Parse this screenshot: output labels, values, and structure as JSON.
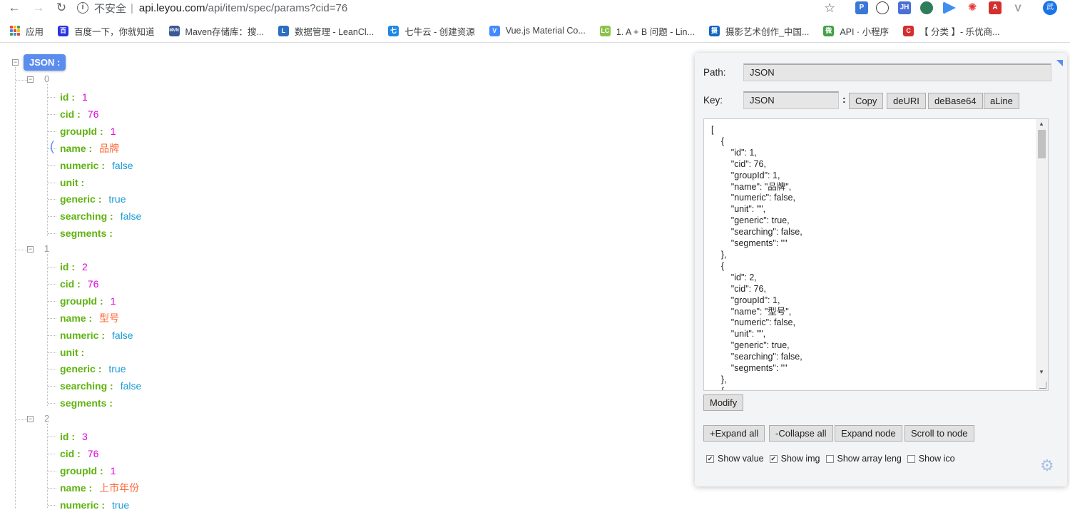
{
  "browser": {
    "insecure_label": "不安全",
    "url_host": "api.leyou.com",
    "url_path": "/api/item/spec/params?cid=76",
    "avatar_text": "武"
  },
  "bookmarks": [
    {
      "label": "应用",
      "icon": "apps-grid-icon"
    },
    {
      "label": "百度一下，你就知道",
      "icon": "baidu-icon",
      "color": "#2932e1",
      "glyph": "百"
    },
    {
      "label": "Maven存储库：搜...",
      "icon": "maven-icon",
      "color": "#3b5998",
      "glyph": "MVN"
    },
    {
      "label": "数据管理 - LeanCl...",
      "icon": "leancloud-icon",
      "color": "#2c6fbf",
      "glyph": "L"
    },
    {
      "label": "七牛云 - 创建资源",
      "icon": "qiniu-icon",
      "color": "#1e88e5",
      "glyph": "七"
    },
    {
      "label": "Vue.js Material Co...",
      "icon": "vue-material-icon",
      "color": "#448aff",
      "glyph": "V"
    },
    {
      "label": "1. A + B 问题 - Lin...",
      "icon": "lintcode-icon",
      "color": "#8bc34a",
      "glyph": "LC"
    },
    {
      "label": "摄影艺术创作_中国...",
      "icon": "photo-icon",
      "color": "#1565c0",
      "glyph": "摄"
    },
    {
      "label": "API · 小程序",
      "icon": "wechat-icon",
      "color": "#43a047",
      "glyph": "微"
    },
    {
      "label": "【 分类 】- 乐优商...",
      "icon": "leyou-icon",
      "color": "#d32f2f",
      "glyph": "C"
    }
  ],
  "tree": {
    "root_label": "JSON :",
    "groups": [
      {
        "index": "0",
        "items": [
          {
            "key": "id :",
            "value": "1",
            "type": "num"
          },
          {
            "key": "cid :",
            "value": "76",
            "type": "num"
          },
          {
            "key": "groupId :",
            "value": "1",
            "type": "num"
          },
          {
            "key": "name :",
            "value": "品牌",
            "type": "str"
          },
          {
            "key": "numeric :",
            "value": "false",
            "type": "bool"
          },
          {
            "key": "unit :",
            "value": "",
            "type": "str"
          },
          {
            "key": "generic :",
            "value": "true",
            "type": "bool"
          },
          {
            "key": "searching :",
            "value": "false",
            "type": "bool"
          },
          {
            "key": "segments :",
            "value": "",
            "type": "str"
          }
        ]
      },
      {
        "index": "1",
        "items": [
          {
            "key": "id :",
            "value": "2",
            "type": "num"
          },
          {
            "key": "cid :",
            "value": "76",
            "type": "num"
          },
          {
            "key": "groupId :",
            "value": "1",
            "type": "num"
          },
          {
            "key": "name :",
            "value": "型号",
            "type": "str"
          },
          {
            "key": "numeric :",
            "value": "false",
            "type": "bool"
          },
          {
            "key": "unit :",
            "value": "",
            "type": "str"
          },
          {
            "key": "generic :",
            "value": "true",
            "type": "bool"
          },
          {
            "key": "searching :",
            "value": "false",
            "type": "bool"
          },
          {
            "key": "segments :",
            "value": "",
            "type": "str"
          }
        ]
      },
      {
        "index": "2",
        "items": [
          {
            "key": "id :",
            "value": "3",
            "type": "num"
          },
          {
            "key": "cid :",
            "value": "76",
            "type": "num"
          },
          {
            "key": "groupId :",
            "value": "1",
            "type": "num"
          },
          {
            "key": "name :",
            "value": "上市年份",
            "type": "str"
          },
          {
            "key": "numeric :",
            "value": "true",
            "type": "bool"
          }
        ]
      }
    ]
  },
  "panel": {
    "path_label": "Path:",
    "path_value": "JSON",
    "key_label": "Key:",
    "key_value": "JSON",
    "colon": ":",
    "buttons": {
      "copy": "Copy",
      "deuri": "deURI",
      "debase64": "deBase64",
      "aline": "aLine",
      "modify": "Modify",
      "expand_all": "+Expand all",
      "collapse_all": "-Collapse all",
      "expand_node": "Expand node",
      "scroll_to_node": "Scroll to node"
    },
    "json_text": "[\n    {\n        \"id\": 1,\n        \"cid\": 76,\n        \"groupId\": 1,\n        \"name\": \"品牌\",\n        \"numeric\": false,\n        \"unit\": \"\",\n        \"generic\": true,\n        \"searching\": false,\n        \"segments\": \"\"\n    },\n    {\n        \"id\": 2,\n        \"cid\": 76,\n        \"groupId\": 1,\n        \"name\": \"型号\",\n        \"numeric\": false,\n        \"unit\": \"\",\n        \"generic\": true,\n        \"searching\": false,\n        \"segments\": \"\"\n    },\n    {",
    "checkboxes": [
      {
        "label": "Show value",
        "checked": true
      },
      {
        "label": "Show img",
        "checked": true
      },
      {
        "label": "Show array leng",
        "checked": false
      },
      {
        "label": "Show ico",
        "checked": false
      }
    ]
  }
}
